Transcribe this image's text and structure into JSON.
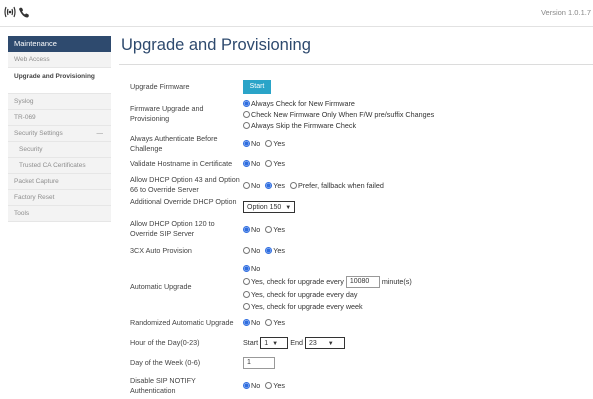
{
  "header": {
    "version": "Version 1.0.1.7"
  },
  "sidebar": {
    "section": "Maintenance",
    "items": [
      {
        "label": "Web Access"
      },
      {
        "label": "Upgrade and Provisioning"
      },
      {
        "label": "Syslog"
      },
      {
        "label": "TR-069"
      },
      {
        "label": "Security Settings",
        "collapse": "—"
      },
      {
        "label": "Security"
      },
      {
        "label": "Trusted CA Certificates"
      },
      {
        "label": "Packet Capture"
      },
      {
        "label": "Factory Reset"
      },
      {
        "label": "Tools"
      }
    ]
  },
  "main": {
    "title": "Upgrade and Provisioning",
    "upgrade_firmware": {
      "label": "Upgrade Firmware",
      "button": "Start"
    },
    "fw_upgrade_provisioning": {
      "label": "Firmware Upgrade and Provisioning",
      "options": [
        "Always Check for New Firmware",
        "Check New Firmware Only When F/W pre/suffix Changes",
        "Always Skip the Firmware Check"
      ],
      "selected": 0
    },
    "always_auth": {
      "label": "Always Authenticate Before Challenge",
      "options": [
        "No",
        "Yes"
      ],
      "selected": 0
    },
    "validate_hostname": {
      "label": "Validate Hostname in Certificate",
      "options": [
        "No",
        "Yes"
      ],
      "selected": 0
    },
    "dhcp_43_66": {
      "label": "Allow DHCP Option 43 and Option 66 to Override Server",
      "options": [
        "No",
        "Yes",
        "Prefer, fallback when failed"
      ],
      "selected": 1
    },
    "additional_override": {
      "label": "Additional Override DHCP Option",
      "value": "Option 150"
    },
    "dhcp_120": {
      "label": "Allow DHCP Option 120 to Override SIP Server",
      "options": [
        "No",
        "Yes"
      ],
      "selected": 0
    },
    "cx_auto": {
      "label": "3CX Auto Provision",
      "options": [
        "No",
        "Yes"
      ],
      "selected": 1
    },
    "automatic_upgrade": {
      "label": "Automatic Upgrade",
      "options": {
        "no": "No",
        "every_pre": "Yes, check for upgrade every",
        "every_value": "10080",
        "every_unit": "minute(s)",
        "daily": "Yes, check for upgrade every day",
        "weekly": "Yes, check for upgrade every week"
      },
      "selected": 0
    },
    "randomized": {
      "label": "Randomized Automatic Upgrade",
      "options": [
        "No",
        "Yes"
      ],
      "selected": 0
    },
    "hour_of_day": {
      "label": "Hour of the Day(0-23)",
      "start_label": "Start",
      "start_value": "1",
      "end_label": "End",
      "end_value": "23"
    },
    "day_of_week": {
      "label": "Day of the Week (0-6)",
      "value": "1"
    },
    "disable_notify": {
      "label": "Disable SIP NOTIFY Authentication",
      "options": [
        "No",
        "Yes"
      ],
      "selected": 0
    }
  },
  "colors": {
    "accent": "#2e4a6e",
    "button": "#2aa4c8",
    "radio": "#2e6de0"
  }
}
